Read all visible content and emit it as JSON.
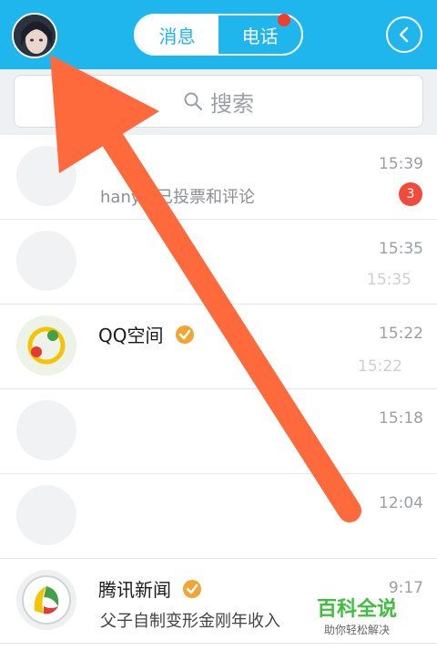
{
  "header": {
    "tabs": [
      {
        "label": "消息",
        "active": true
      },
      {
        "label": "电话",
        "active": false
      }
    ],
    "brand_color": "#1fb6ee"
  },
  "search": {
    "placeholder": "搜索"
  },
  "conversations": [
    {
      "title": "",
      "subtitle": "hanyu:已投票和评论",
      "time": "15:39",
      "unread": "3"
    },
    {
      "title": "",
      "subtitle": "",
      "time": "15:35",
      "extra_time": "15:35"
    },
    {
      "title": "QQ空间",
      "subtitle": "",
      "time": "15:22",
      "extra_time": "15:22"
    },
    {
      "title": "",
      "subtitle": "",
      "time": "15:18"
    },
    {
      "title": "",
      "subtitle": "",
      "time": "12:04"
    },
    {
      "title": "腾讯新闻",
      "subtitle": "父子自制变形金刚年收入",
      "time": "9:17"
    }
  ],
  "watermark": {
    "title": "百科全说",
    "subtitle": "助你轻松解决"
  },
  "colors": {
    "unread_badge": "#f24b3b",
    "arrow": "#ff6a3d",
    "verified": "#f3a531"
  }
}
